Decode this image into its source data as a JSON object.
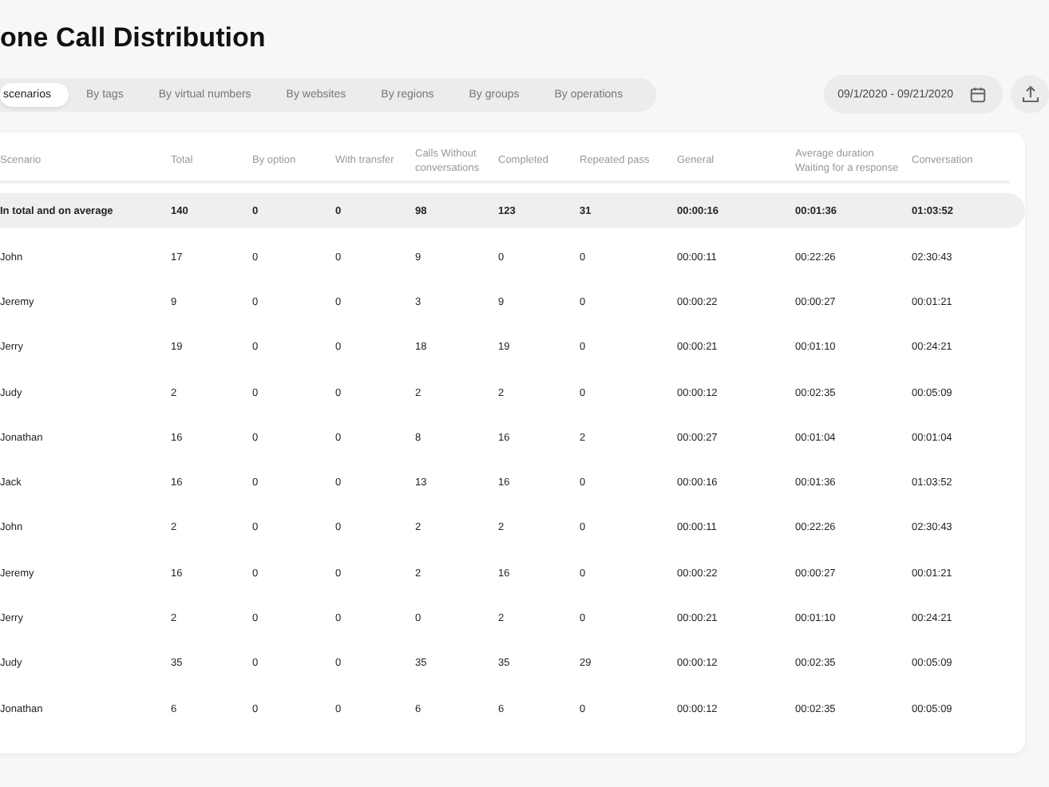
{
  "title": "one Call Distribution",
  "tabs": [
    {
      "label": "scenarios",
      "selected": true
    },
    {
      "label": "By tags",
      "selected": false
    },
    {
      "label": "By virtual numbers",
      "selected": false
    },
    {
      "label": "By websites",
      "selected": false
    },
    {
      "label": "By regions",
      "selected": false
    },
    {
      "label": "By groups",
      "selected": false
    },
    {
      "label": "By operations",
      "selected": false
    }
  ],
  "date_range": "09/1/2020 - 09/21/2020",
  "table": {
    "columns": [
      "Scenario",
      "Total",
      "By option",
      "With transfer",
      "Calls Without conversations",
      "Completed",
      "Repeated pass",
      "General",
      "Average duration Waiting for a response",
      "Conversation"
    ],
    "total_row": [
      "In total and on average",
      "140",
      "0",
      "0",
      "98",
      "123",
      "31",
      "00:00:16",
      "00:01:36",
      "01:03:52"
    ],
    "rows": [
      [
        "John",
        "17",
        "0",
        "0",
        "9",
        "0",
        "0",
        "00:00:11",
        "00:22:26",
        "02:30:43"
      ],
      [
        "Jeremy",
        "9",
        "0",
        "0",
        "3",
        "9",
        "0",
        "00:00:22",
        "00:00:27",
        "00:01:21"
      ],
      [
        "Jerry",
        "19",
        "0",
        "0",
        "18",
        "19",
        "0",
        "00:00:21",
        "00:01:10",
        "00:24:21"
      ],
      [
        "Judy",
        "2",
        "0",
        "0",
        "2",
        "2",
        "0",
        "00:00:12",
        "00:02:35",
        "00:05:09"
      ],
      [
        "Jonathan",
        "16",
        "0",
        "0",
        "8",
        "16",
        "2",
        "00:00:27",
        "00:01:04",
        "00:01:04"
      ],
      [
        "Jack",
        "16",
        "0",
        "0",
        "13",
        "16",
        "0",
        "00:00:16",
        "00:01:36",
        "01:03:52"
      ],
      [
        "John",
        "2",
        "0",
        "0",
        "2",
        "2",
        "0",
        "00:00:11",
        "00:22:26",
        "02:30:43"
      ],
      [
        "Jeremy",
        "16",
        "0",
        "0",
        "2",
        "16",
        "0",
        "00:00:22",
        "00:00:27",
        "00:01:21"
      ],
      [
        "Jerry",
        "2",
        "0",
        "0",
        "0",
        "2",
        "0",
        "00:00:21",
        "00:01:10",
        "00:24:21"
      ],
      [
        "Judy",
        "35",
        "0",
        "0",
        "35",
        "35",
        "29",
        "00:00:12",
        "00:02:35",
        "00:05:09"
      ],
      [
        "Jonathan",
        "6",
        "0",
        "0",
        "6",
        "6",
        "0",
        "00:00:12",
        "00:02:35",
        "00:05:09"
      ]
    ]
  }
}
